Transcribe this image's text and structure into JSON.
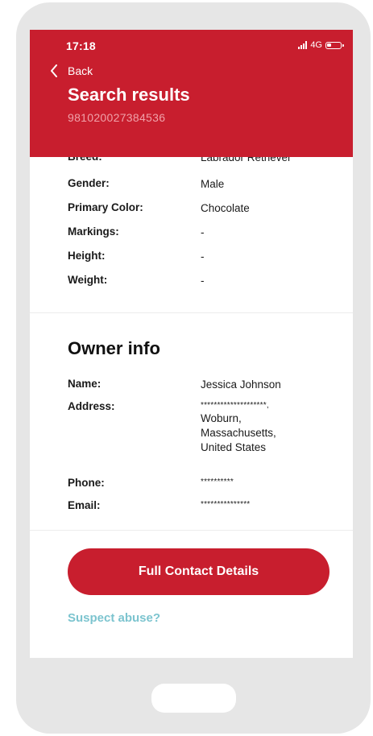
{
  "status_bar": {
    "time": "17:18",
    "network": "4G"
  },
  "header": {
    "back_label": "Back",
    "title": "Search results",
    "subtitle": "981020027384536"
  },
  "pet_info": {
    "rows": [
      {
        "label": "Breed:",
        "value": "Labrador Retriever"
      },
      {
        "label": "Gender:",
        "value": "Male"
      },
      {
        "label": "Primary Color:",
        "value": "Chocolate"
      },
      {
        "label": "Markings:",
        "value": "-"
      },
      {
        "label": "Height:",
        "value": "-"
      },
      {
        "label": "Weight:",
        "value": "-"
      }
    ]
  },
  "owner_info": {
    "title": "Owner info",
    "name_label": "Name:",
    "name_value": "Jessica Johnson",
    "address_label": "Address:",
    "address_line1": "********************,",
    "address_line2": "Woburn,",
    "address_line3": "Massachusetts,",
    "address_line4": "United States",
    "phone_label": "Phone:",
    "phone_value": "**********",
    "email_label": "Email:",
    "email_value": "***************"
  },
  "actions": {
    "full_contact_label": "Full Contact Details",
    "suspect_abuse_label": "Suspect abuse?"
  },
  "colors": {
    "brand_red": "#c81e2e",
    "link_teal": "#7cc4cf",
    "phone_frame": "#e6e6e6"
  }
}
